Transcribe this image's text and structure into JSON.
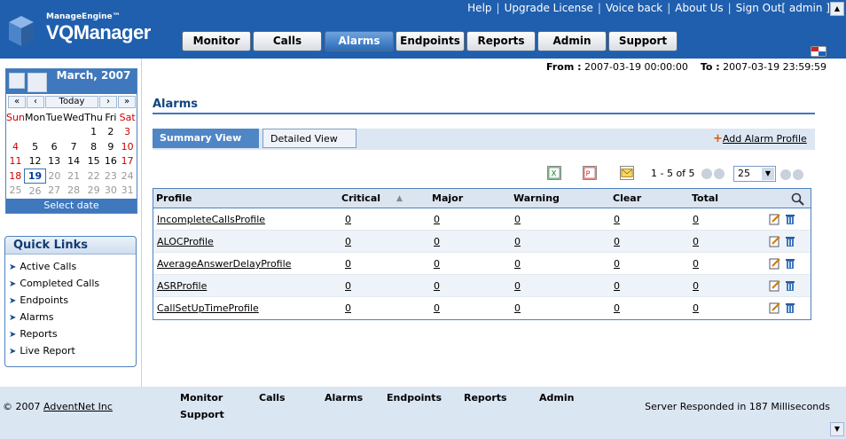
{
  "header": {
    "brand_top": "ManageEngine™",
    "brand_name": "VQManager",
    "top_links": [
      "Help",
      "Upgrade License",
      "Voice back",
      "About Us",
      "Sign Out[ admin ]"
    ],
    "nav": [
      "Monitor",
      "Calls",
      "Alarms",
      "Endpoints",
      "Reports",
      "Admin",
      "Support"
    ],
    "active_nav": "Alarms"
  },
  "calendar": {
    "month_label": "March, 2007",
    "nav_prev_year": "«",
    "nav_prev_month": "‹",
    "today_label": "Today",
    "nav_next_month": "›",
    "nav_next_year": "»",
    "day_names": [
      "Sun",
      "Mon",
      "Tue",
      "Wed",
      "Thu",
      "Fri",
      "Sat"
    ],
    "weeks": [
      [
        "",
        "",
        "",
        "",
        "1",
        "2",
        "3"
      ],
      [
        "4",
        "5",
        "6",
        "7",
        "8",
        "9",
        "10"
      ],
      [
        "11",
        "12",
        "13",
        "14",
        "15",
        "16",
        "17"
      ],
      [
        "18",
        "19",
        "20",
        "21",
        "22",
        "23",
        "24"
      ],
      [
        "25",
        "26",
        "27",
        "28",
        "29",
        "30",
        "31"
      ]
    ],
    "today": "19",
    "select_date": "Select date"
  },
  "quick_links": {
    "title": "Quick Links",
    "items": [
      "Active Calls",
      "Completed Calls",
      "Endpoints",
      "Alarms",
      "Reports",
      "Live Report"
    ]
  },
  "range": {
    "from_label": "From :",
    "from_value": "2007-03-19 00:00:00",
    "to_label": "To :",
    "to_value": "2007-03-19 23:59:59"
  },
  "page": {
    "title": "Alarms",
    "tab_summary": "Summary View",
    "tab_detailed": "Detailed View",
    "add_profile": "Add Alarm Profile"
  },
  "pager": {
    "range_text": "1 - 5 of 5",
    "page_size": "25"
  },
  "table": {
    "columns": [
      "Profile",
      "Critical",
      "Major",
      "Warning",
      "Clear",
      "Total"
    ],
    "sort_indicator": "▲",
    "rows": [
      {
        "profile": "IncompleteCallsProfile",
        "critical": "0",
        "major": "0",
        "warning": "0",
        "clear": "0",
        "total": "0"
      },
      {
        "profile": "ALOCProfile",
        "critical": "0",
        "major": "0",
        "warning": "0",
        "clear": "0",
        "total": "0"
      },
      {
        "profile": "AverageAnswerDelayProfile",
        "critical": "0",
        "major": "0",
        "warning": "0",
        "clear": "0",
        "total": "0"
      },
      {
        "profile": "ASRProfile",
        "critical": "0",
        "major": "0",
        "warning": "0",
        "clear": "0",
        "total": "0"
      },
      {
        "profile": "CallSetUpTimeProfile",
        "critical": "0",
        "major": "0",
        "warning": "0",
        "clear": "0",
        "total": "0"
      }
    ]
  },
  "footer": {
    "copyright_prefix": "© 2007",
    "company": "AdventNet Inc",
    "nav": [
      "Monitor",
      "Calls",
      "Alarms",
      "Endpoints",
      "Reports",
      "Admin",
      "Support"
    ],
    "server_text": "Server Responded in 187 Milliseconds"
  },
  "colors": {
    "header_bg": "#1f5fae",
    "accent": "#3f78bd",
    "title_blue": "#11457f"
  }
}
